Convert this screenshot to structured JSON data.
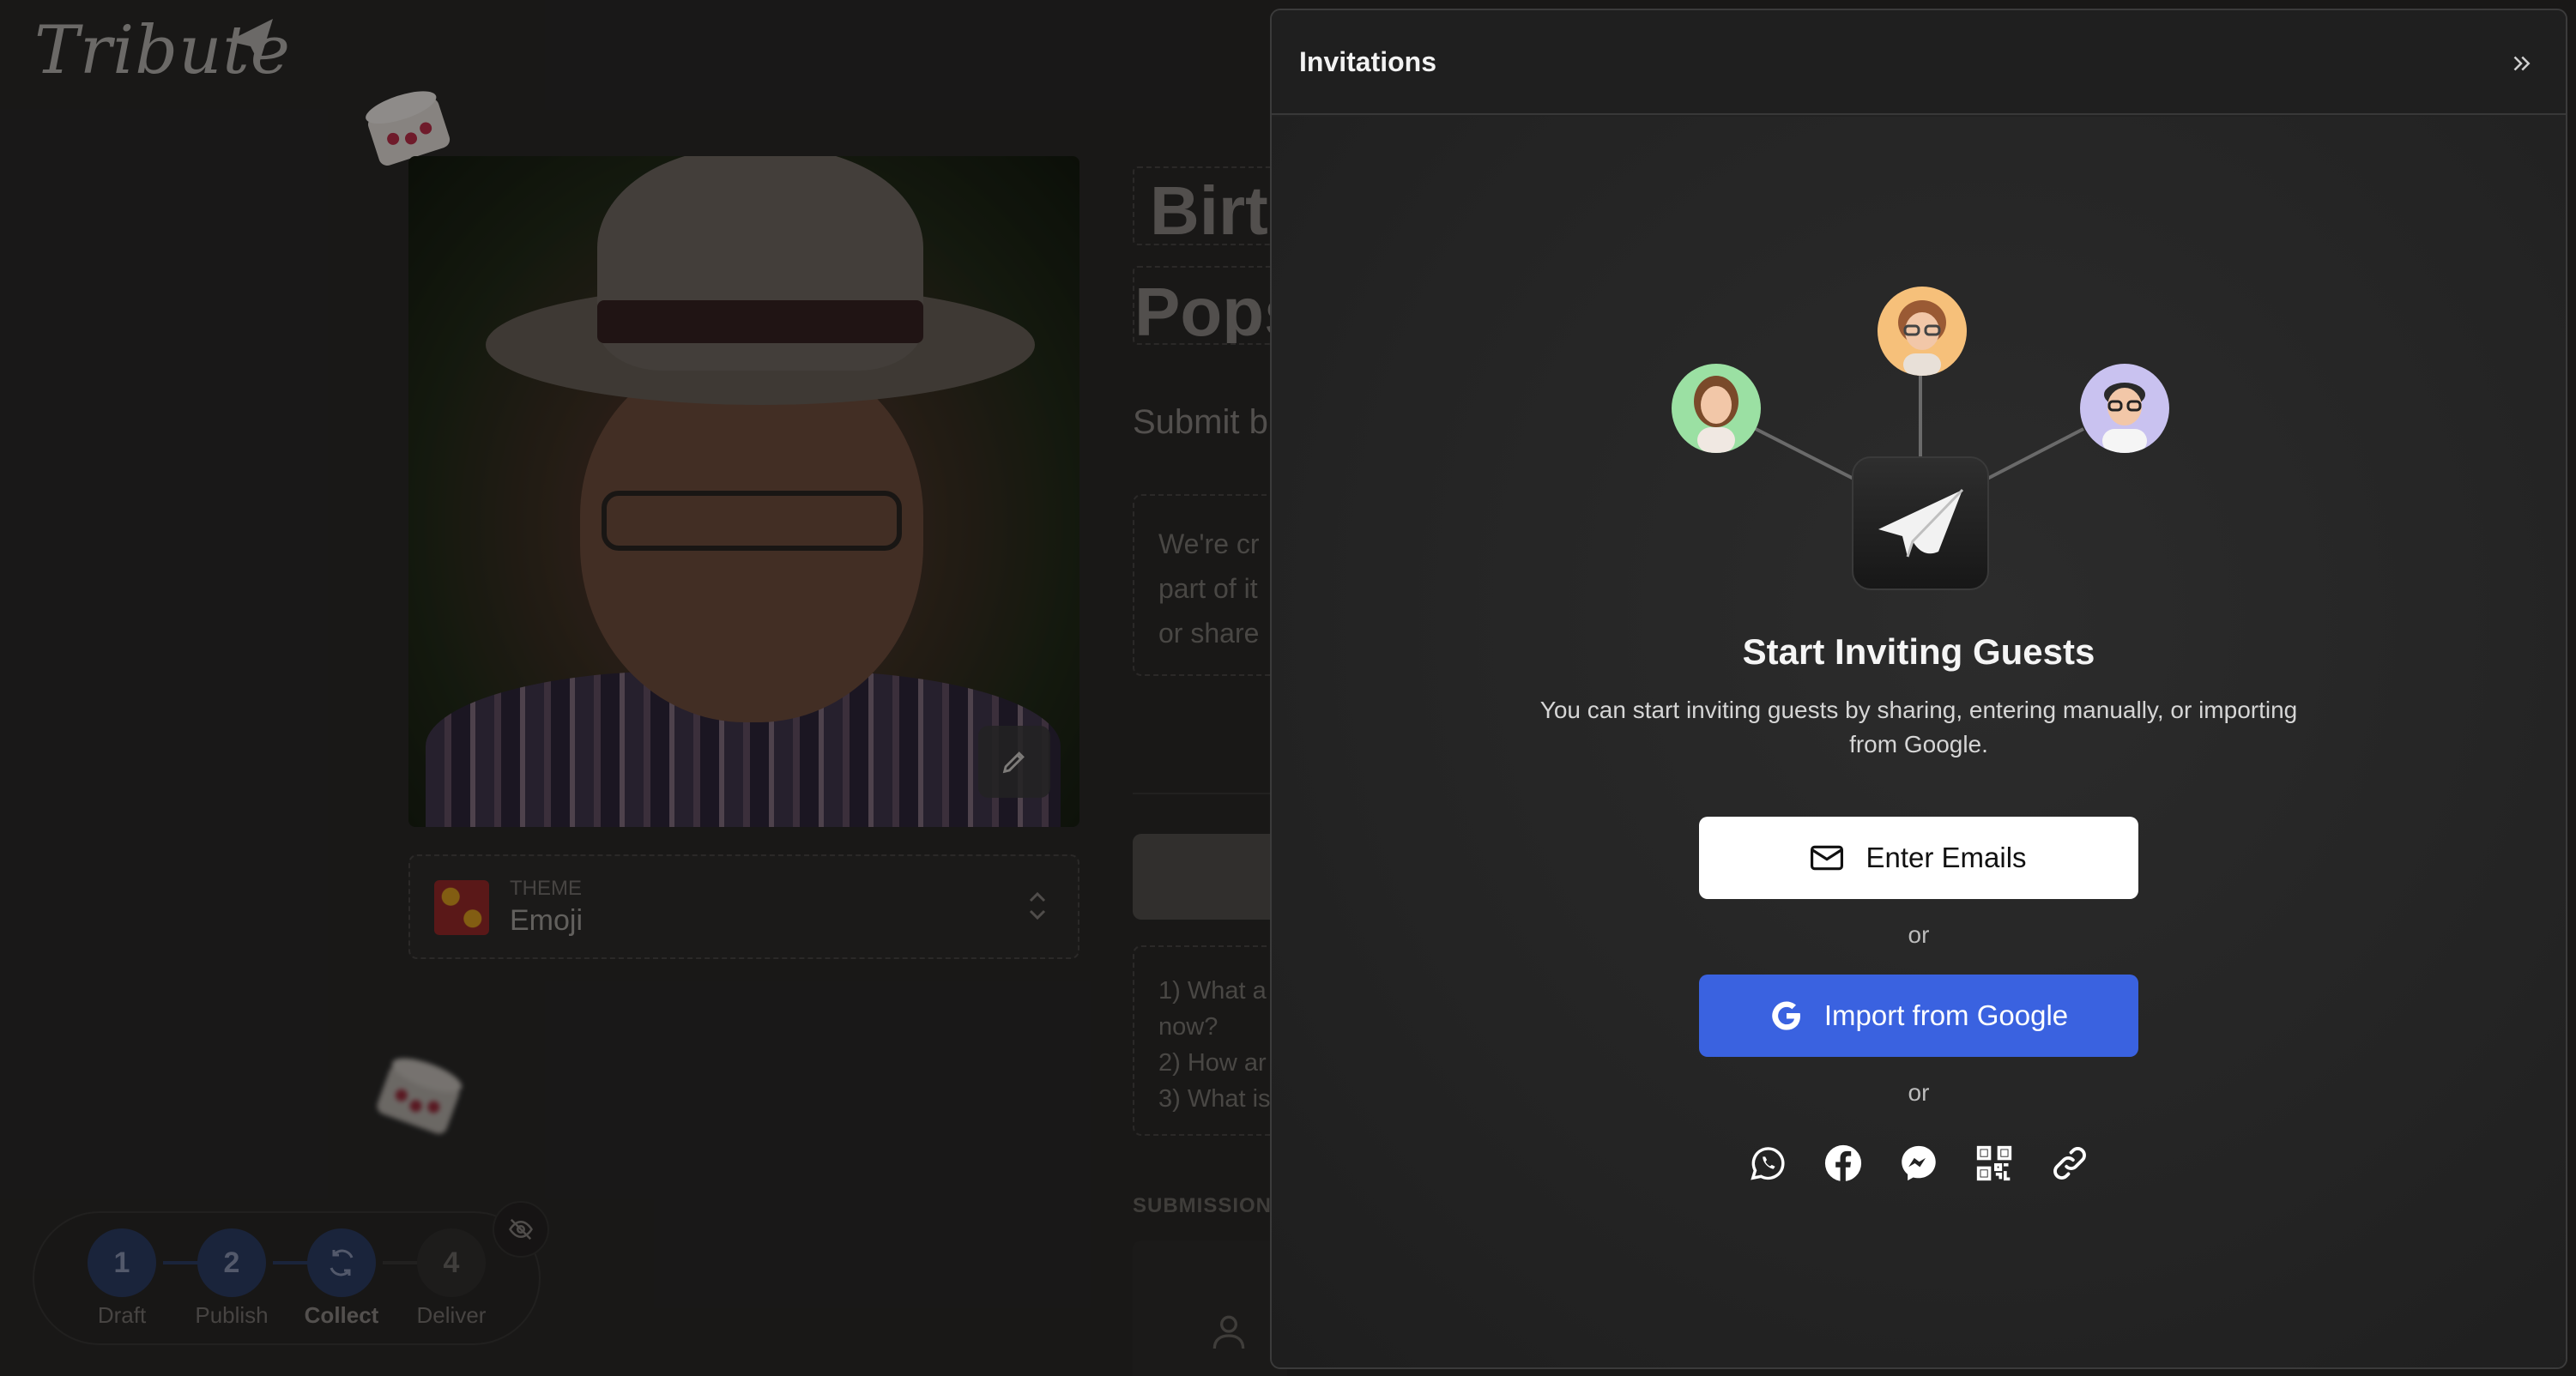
{
  "background": {
    "logo_text": "Tribute",
    "title_fragment": "Birt",
    "subtitle_fragment": "Pops",
    "submit_fragment": "Submit b",
    "description_lines": [
      "We're cr",
      "part of it",
      "or share"
    ],
    "theme": {
      "label": "THEME",
      "value": "Emoji"
    },
    "questions": [
      "1) What a",
      "now?",
      "2) How ar",
      "3) What is"
    ],
    "submissions_label": "SUBMISSIONS",
    "stepper": [
      {
        "number": "1",
        "label": "Draft"
      },
      {
        "number": "2",
        "label": "Publish"
      },
      {
        "number": "",
        "label": "Collect"
      },
      {
        "number": "4",
        "label": "Deliver"
      }
    ]
  },
  "panel": {
    "title": "Invitations",
    "headline": "Start Inviting Guests",
    "subtext": "You can start inviting guests by sharing, entering manually, or importing from Google.",
    "enter_emails_label": "Enter Emails",
    "or_label": "or",
    "import_google_label": "Import from Google",
    "share_icons": [
      "whatsapp-icon",
      "facebook-icon",
      "messenger-icon",
      "qr-code-icon",
      "link-icon"
    ]
  },
  "colors": {
    "google_button": "#3a62e0",
    "panel_bg": "#222222",
    "stepper_active": "#2e3f66"
  }
}
